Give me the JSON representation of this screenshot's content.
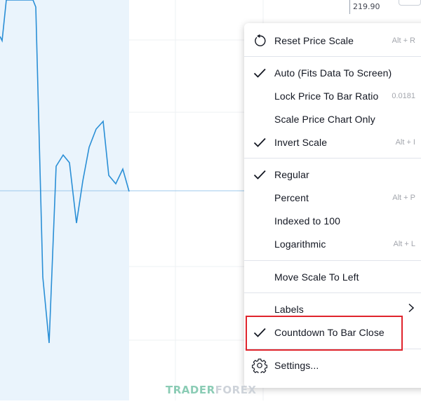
{
  "price_scale": {
    "top_label": "219.90"
  },
  "menu": {
    "reset": {
      "label": "Reset Price Scale",
      "shortcut": "Alt + R",
      "icon": "reset-icon"
    },
    "auto": {
      "label": "Auto (Fits Data To Screen)",
      "checked": true
    },
    "lock_ratio": {
      "label": "Lock Price To Bar Ratio",
      "value": "0.0181"
    },
    "scale_chart_only": {
      "label": "Scale Price Chart Only"
    },
    "invert": {
      "label": "Invert Scale",
      "shortcut": "Alt + I",
      "checked": true
    },
    "regular": {
      "label": "Regular",
      "checked": true
    },
    "percent": {
      "label": "Percent",
      "shortcut": "Alt + P"
    },
    "indexed": {
      "label": "Indexed to 100"
    },
    "log": {
      "label": "Logarithmic",
      "shortcut": "Alt + L"
    },
    "move_left": {
      "label": "Move Scale To Left"
    },
    "labels": {
      "label": "Labels",
      "icon": "chevron-right-icon"
    },
    "countdown": {
      "label": "Countdown To Bar Close",
      "checked": true
    },
    "settings": {
      "label": "Settings...",
      "icon": "gear-icon"
    }
  },
  "watermark": {
    "part1": "TRADER",
    "part2": "FOREX"
  },
  "colors": {
    "line": "#2a8fd6",
    "area_fill": "#eaf4fc",
    "highlight": "#e0242c",
    "grid": "#eef0f3"
  }
}
